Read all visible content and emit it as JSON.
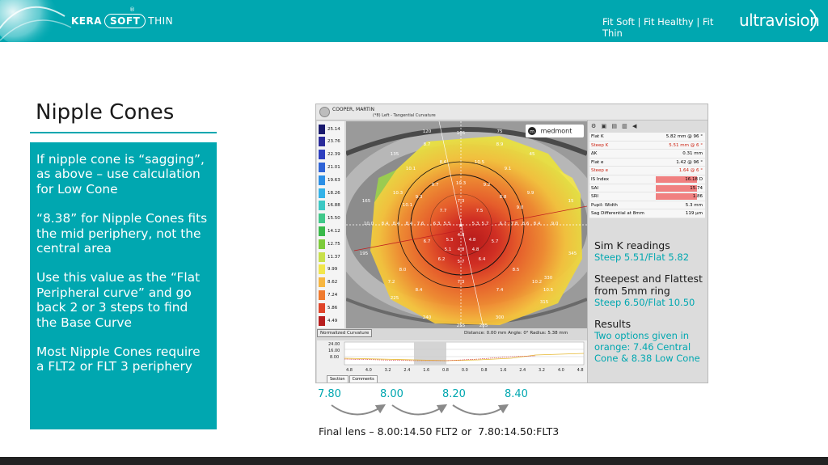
{
  "header": {
    "brand": {
      "kera": "KERA",
      "soft": "SOFT",
      "thin": "THIN",
      "reg": "®"
    },
    "tagline": "Fit Soft | Fit Healthy | Fit Thin",
    "logo": "ultravision",
    "color": "#00a7b0"
  },
  "title": "Nipple Cones",
  "textbox": {
    "color": "#00a7b0",
    "paragraphs": [
      "If nipple cone is “sagging”, as above – use calculation for Low Cone",
      "“8.38” for Nipple Cones fits the mid periphery, not the central area",
      "Use this value as the “Flat Peripheral curve” and go back 2 or 3 steps to find the Base Curve",
      "Most Nipple Cones require a FLT2 or FLT 3 periphery"
    ]
  },
  "topography": {
    "patient": "COOPER, MARTIN",
    "view": "(*8) Left - Tangential Curvature",
    "brand": "medmont",
    "scale_values": [
      "25.14",
      "23.76",
      "22.39",
      "21.01",
      "19.63",
      "18.26",
      "16.88",
      "15.50",
      "14.12",
      "12.75",
      "11.37",
      "9.99",
      "8.62",
      "7.24",
      "5.86",
      "4.49"
    ],
    "scale_colors": [
      "#1a1a6e",
      "#2a2a9a",
      "#2e3fbf",
      "#2f63d6",
      "#2b8fe6",
      "#33b2e8",
      "#3cc8c4",
      "#40c88a",
      "#39b94a",
      "#7ccb3a",
      "#c8e04a",
      "#f2e64c",
      "#f7b640",
      "#ef7a2e",
      "#e0452a",
      "#b81e1e"
    ],
    "norm_label": "Normalized Curvature",
    "meta": "Distance: 0.00 mm   Angle: 0°   Radius: 5.38 mm",
    "profile_y": [
      "24.00",
      "16.00",
      "8.00"
    ],
    "profile_x": [
      "4.8",
      "4.0",
      "3.2",
      "2.4",
      "1.6",
      "0.8",
      "0.0",
      "0.8",
      "1.6",
      "2.4",
      "3.2",
      "4.0",
      "4.8"
    ],
    "profile_tabs": [
      "Section",
      "Comments"
    ],
    "icons": "⚙ ▣ ▤ ▥ ◀",
    "krows": [
      {
        "label": "Flat K",
        "value": "5.82 mm @  96 °",
        "red": false,
        "bar": false
      },
      {
        "label": "Steep K",
        "value": "5.51 mm @   6 °",
        "red": true,
        "bar": false
      },
      {
        "label": "ΔK",
        "value": "0.31 mm",
        "red": false,
        "bar": false
      },
      {
        "label": "Flat e",
        "value": "1.42 @  96 °",
        "red": false,
        "bar": false
      },
      {
        "label": "Steep e",
        "value": "1.64 @   6 °",
        "red": true,
        "bar": false
      },
      {
        "label": "IS Index",
        "value": "16.18 D",
        "red": false,
        "bar": true
      },
      {
        "label": "SAI",
        "value": "15.74",
        "red": false,
        "bar": true
      },
      {
        "label": "SRI",
        "value": "1.86",
        "red": false,
        "bar": true
      },
      {
        "label": "Pupil: Width",
        "value": "5.3 mm",
        "red": false,
        "bar": false
      },
      {
        "label": "Sag Differential at 8mm",
        "value": "119 μm",
        "red": false,
        "bar": false
      }
    ]
  },
  "notes": [
    {
      "heading": "Sim K readings",
      "text": "Steep 5.51/Flat 5.82"
    },
    {
      "heading": "Steepest and Flattest from 5mm ring",
      "text": "Steep 6.50/Flat 10.50"
    },
    {
      "heading": "Results",
      "text": "Two options given in orange: 7.46 Central Cone & 8.38 Low Cone"
    }
  ],
  "steps": [
    "7.80",
    "8.00",
    "8.20",
    "8.40"
  ],
  "final_lens": "Final lens – 8.00:14.50 FLT2 or  7.80:14.50:FLT3"
}
